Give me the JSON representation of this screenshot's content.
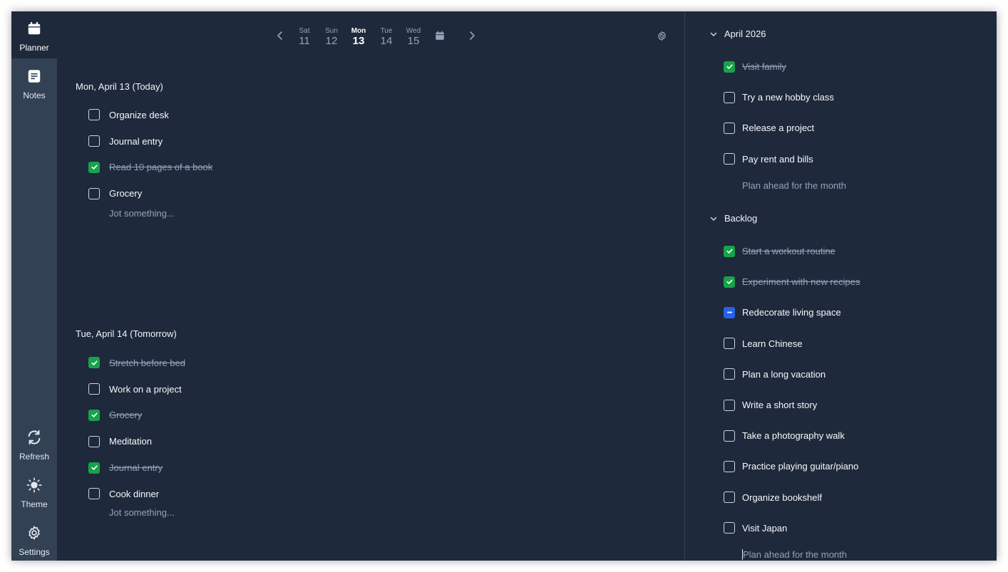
{
  "sidebar": {
    "items": [
      {
        "label": "Planner",
        "icon": "calendar-icon",
        "active": true
      },
      {
        "label": "Notes",
        "icon": "notes-icon",
        "active": false
      }
    ],
    "bottom": [
      {
        "label": "Refresh",
        "icon": "refresh-icon"
      },
      {
        "label": "Theme",
        "icon": "sun-icon"
      },
      {
        "label": "Settings",
        "icon": "gear-icon"
      }
    ]
  },
  "datebar": {
    "days": [
      {
        "name": "Sat",
        "date": "11"
      },
      {
        "name": "Sun",
        "date": "12"
      },
      {
        "name": "Mon",
        "date": "13"
      },
      {
        "name": "Tue",
        "date": "14"
      },
      {
        "name": "Wed",
        "date": "15"
      }
    ],
    "active_day": "Mon"
  },
  "today": {
    "title": "Mon, April 13 (Today)",
    "tasks": [
      {
        "label": "Organize desk",
        "done": false
      },
      {
        "label": "Journal entry",
        "done": false
      },
      {
        "label": "Read 10 pages of a book",
        "done": true
      },
      {
        "label": "Grocery",
        "done": false
      }
    ],
    "placeholder": "Jot something..."
  },
  "tomorrow": {
    "title": "Tue, April 14 (Tomorrow)",
    "tasks": [
      {
        "label": "Stretch before bed",
        "done": true
      },
      {
        "label": "Work on a project",
        "done": false
      },
      {
        "label": "Grocery",
        "done": true
      },
      {
        "label": "Meditation",
        "done": false
      },
      {
        "label": "Journal entry",
        "done": true
      },
      {
        "label": "Cook dinner",
        "done": false
      }
    ],
    "placeholder": "Jot something..."
  },
  "month": {
    "title": "April 2026",
    "tasks": [
      {
        "label": "Visit family",
        "done": true
      },
      {
        "label": "Try a new hobby class",
        "done": false
      },
      {
        "label": "Release a project",
        "done": false
      },
      {
        "label": "Pay rent and bills",
        "done": false
      }
    ],
    "placeholder": "Plan ahead for the month"
  },
  "backlog": {
    "title": "Backlog",
    "tasks": [
      {
        "label": "Start a workout routine",
        "done": true
      },
      {
        "label": "Experiment with new recipes",
        "done": true
      },
      {
        "label": "Redecorate living space",
        "done": false,
        "partial": true
      },
      {
        "label": "Learn Chinese",
        "done": false
      },
      {
        "label": "Plan a long vacation",
        "done": false
      },
      {
        "label": "Write a short story",
        "done": false
      },
      {
        "label": "Take a photography walk",
        "done": false
      },
      {
        "label": "Practice playing guitar/piano",
        "done": false
      },
      {
        "label": "Organize bookshelf",
        "done": false
      },
      {
        "label": "Visit Japan",
        "done": false
      }
    ],
    "placeholder": "Plan ahead for the month"
  },
  "colors": {
    "background": "#1e293b",
    "sidebar": "#334155",
    "done": "#16a34a",
    "partial": "#2563eb"
  }
}
